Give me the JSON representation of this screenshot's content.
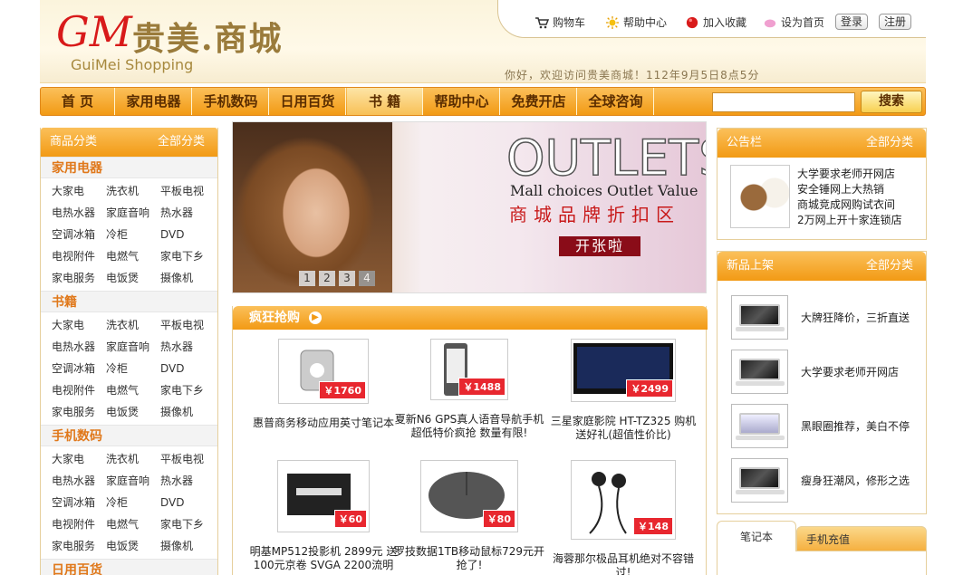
{
  "logo": {
    "mark": "GM",
    "cn": "贵美.商城",
    "en": "GuiMei Shopping"
  },
  "toplinks": {
    "cart": "购物车",
    "help": "帮助中心",
    "favorite": "加入收藏",
    "homepage": "设为首页",
    "login": "登录",
    "register": "注册"
  },
  "greeting": "你好，欢迎访问贵美商城！112年9月5日8点5分",
  "nav": {
    "items": [
      "首  页",
      "家用电器",
      "手机数码",
      "日用百货",
      "书  籍",
      "帮助中心",
      "免费开店",
      "全球咨询"
    ],
    "search_button": "搜索"
  },
  "leftbar": {
    "title": "商品分类",
    "all": "全部分类",
    "categories": [
      {
        "title": "家用电器",
        "items": [
          "大家电",
          "洗衣机",
          "平板电视",
          "电热水器",
          "家庭音响",
          "热水器",
          "空调冰箱",
          "冷柜",
          "DVD",
          "电视附件",
          "电燃气",
          "家电下乡",
          "家电服务",
          "电饭煲",
          "摄像机"
        ]
      },
      {
        "title": "书籍",
        "items": [
          "大家电",
          "洗衣机",
          "平板电视",
          "电热水器",
          "家庭音响",
          "热水器",
          "空调冰箱",
          "冷柜",
          "DVD",
          "电视附件",
          "电燃气",
          "家电下乡",
          "家电服务",
          "电饭煲",
          "摄像机"
        ]
      },
      {
        "title": "手机数码",
        "items": [
          "大家电",
          "洗衣机",
          "平板电视",
          "电热水器",
          "家庭音响",
          "热水器",
          "空调冰箱",
          "冷柜",
          "DVD",
          "电视附件",
          "电燃气",
          "家电下乡",
          "家电服务",
          "电饭煲",
          "摄像机"
        ]
      },
      {
        "title": "日用百货",
        "items": []
      }
    ]
  },
  "banner": {
    "title": "OUTLETS",
    "subtitle_en": "Mall choices Outlet Value",
    "subtitle_cn": "商城品牌折扣区",
    "badge": "开张啦",
    "pages": [
      "1",
      "2",
      "3",
      "4"
    ]
  },
  "crazy": {
    "title": "疯狂抢购",
    "products": [
      {
        "price": "￥1760",
        "name": "惠普商务移动应用英寸笔记本"
      },
      {
        "price": "￥1488",
        "name": "夏新N6 GPS真人语音导航手机 超低特价疯抢 数量有限!"
      },
      {
        "price": "￥2499",
        "name": "三星家庭影院 HT-TZ325 购机送好礼(超值性价比)"
      },
      {
        "price": "￥60",
        "name": "明基MP512投影机 2899元 送100元京卷 SVGA 2200流明"
      },
      {
        "price": "￥80",
        "name": "罗技数据1TB移动鼠标729元开抢了!"
      },
      {
        "price": "￥148",
        "name": "海蓉那尔极品耳机绝对不容错过!"
      }
    ]
  },
  "notice": {
    "title": "公告栏",
    "all": "全部分类",
    "items": [
      "大学要求老师开网店",
      "安全锤网上大热销",
      "商城竞成网购试衣间",
      "2万网上开十家连锁店"
    ]
  },
  "newproducts": {
    "title": "新品上架",
    "all": "全部分类",
    "items": [
      "大牌狂降价，三折直送",
      "大学要求老师开网店",
      "黑眼圈推荐，美白不停",
      "瘦身狂潮风，修形之选"
    ]
  },
  "tabs": {
    "tab1": "笔记本",
    "tab2": "手机充值"
  }
}
